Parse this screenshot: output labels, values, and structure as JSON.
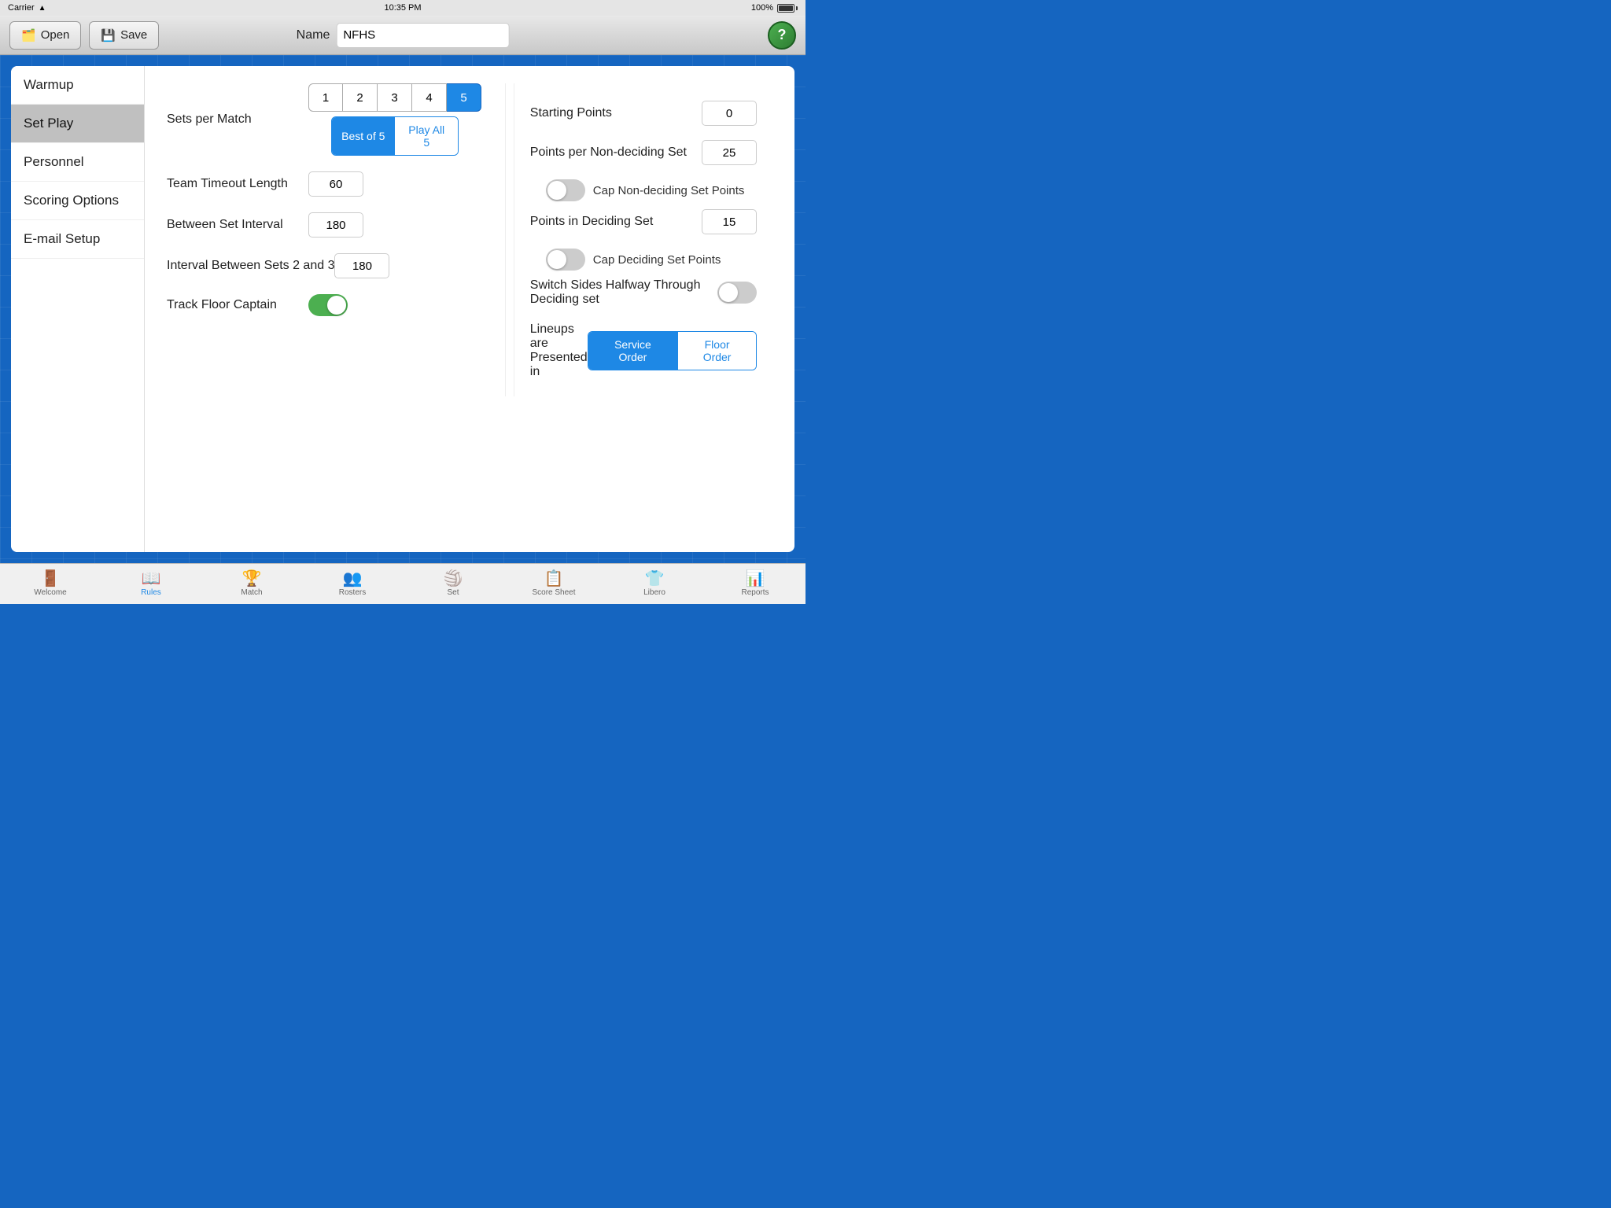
{
  "statusBar": {
    "carrier": "Carrier",
    "time": "10:35 PM",
    "battery": "100%"
  },
  "toolbar": {
    "open_label": "Open",
    "save_label": "Save",
    "name_label": "Name",
    "name_value": "NFHS",
    "help_label": "?"
  },
  "sidebar": {
    "items": [
      {
        "id": "warmup",
        "label": "Warmup",
        "active": false
      },
      {
        "id": "set-play",
        "label": "Set Play",
        "active": true
      },
      {
        "id": "personnel",
        "label": "Personnel",
        "active": false
      },
      {
        "id": "scoring-options",
        "label": "Scoring Options",
        "active": false
      },
      {
        "id": "email-setup",
        "label": "E-mail Setup",
        "active": false
      }
    ]
  },
  "setPlay": {
    "sets_per_match_label": "Sets per Match",
    "set_buttons": [
      "1",
      "2",
      "3",
      "4",
      "5"
    ],
    "active_set": "5",
    "best_of_label": "Best of 5",
    "play_all_label": "Play All 5",
    "active_mode": "best_of",
    "team_timeout_label": "Team Timeout Length",
    "team_timeout_value": "60",
    "between_set_label": "Between Set Interval",
    "between_set_value": "180",
    "interval_23_label": "Interval Between Sets 2 and 3",
    "interval_23_value": "180",
    "track_floor_label": "Track Floor Captain",
    "track_floor_on": true
  },
  "rightCol": {
    "starting_points_label": "Starting Points",
    "starting_points_value": "0",
    "non_deciding_label": "Points per Non-deciding Set",
    "non_deciding_value": "25",
    "cap_non_deciding_label": "Cap Non-deciding Set Points",
    "cap_non_deciding_on": false,
    "deciding_label": "Points in Deciding Set",
    "deciding_value": "15",
    "cap_deciding_label": "Cap Deciding Set Points",
    "cap_deciding_on": false,
    "switch_sides_label": "Switch Sides Halfway Through Deciding set",
    "switch_sides_on": false,
    "lineups_label": "Lineups are Presented in",
    "service_order_label": "Service Order",
    "floor_order_label": "Floor Order",
    "active_lineup": "service_order"
  },
  "tabBar": {
    "tabs": [
      {
        "id": "welcome",
        "label": "Welcome",
        "icon": "🚪",
        "active": false
      },
      {
        "id": "rules",
        "label": "Rules",
        "icon": "📖",
        "active": true
      },
      {
        "id": "match",
        "label": "Match",
        "icon": "🏆",
        "active": false
      },
      {
        "id": "rosters",
        "label": "Rosters",
        "icon": "👥",
        "active": false
      },
      {
        "id": "set",
        "label": "Set",
        "icon": "🏐",
        "active": false
      },
      {
        "id": "score-sheet",
        "label": "Score Sheet",
        "icon": "📋",
        "active": false
      },
      {
        "id": "libero",
        "label": "Libero",
        "icon": "👕",
        "active": false
      },
      {
        "id": "reports",
        "label": "Reports",
        "icon": "📊",
        "active": false
      }
    ]
  }
}
